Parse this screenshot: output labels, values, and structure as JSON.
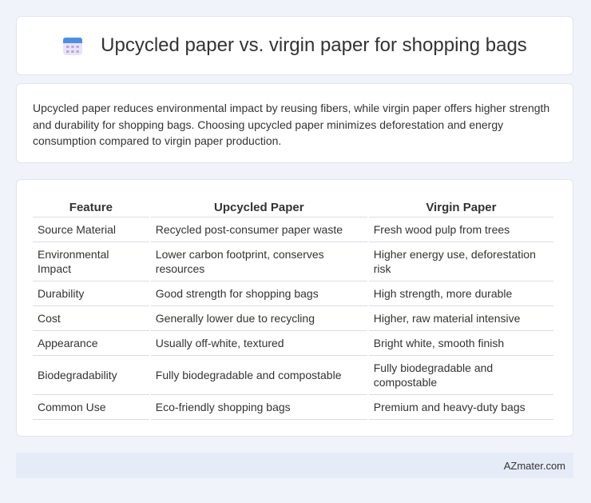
{
  "header": {
    "title": "Upcycled paper vs. virgin paper for shopping bags",
    "icon": "calendar-icon"
  },
  "summary": "Upcycled paper reduces environmental impact by reusing fibers, while virgin paper offers higher strength and durability for shopping bags. Choosing upcycled paper minimizes deforestation and energy consumption compared to virgin paper production.",
  "table": {
    "headers": [
      "Feature",
      "Upcycled Paper",
      "Virgin Paper"
    ],
    "rows": [
      [
        "Source Material",
        "Recycled post-consumer paper waste",
        "Fresh wood pulp from trees"
      ],
      [
        "Environmental Impact",
        "Lower carbon footprint, conserves resources",
        "Higher energy use, deforestation risk"
      ],
      [
        "Durability",
        "Good strength for shopping bags",
        "High strength, more durable"
      ],
      [
        "Cost",
        "Generally lower due to recycling",
        "Higher, raw material intensive"
      ],
      [
        "Appearance",
        "Usually off-white, textured",
        "Bright white, smooth finish"
      ],
      [
        "Biodegradability",
        "Fully biodegradable and compostable",
        "Fully biodegradable and compostable"
      ],
      [
        "Common Use",
        "Eco-friendly shopping bags",
        "Premium and heavy-duty bags"
      ]
    ]
  },
  "footer": {
    "brand": "AZmater.com"
  },
  "colors": {
    "background": "#f0f3f9",
    "card": "#ffffff",
    "footer": "#e6ecf7",
    "icon_blue": "#4a8fe6",
    "icon_purple": "#b9a6e8"
  }
}
